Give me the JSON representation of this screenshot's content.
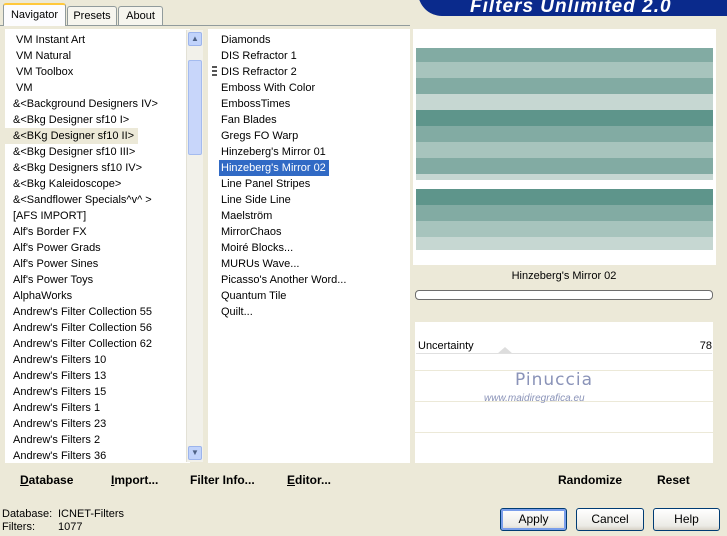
{
  "tabs": [
    {
      "label": "Navigator",
      "active": true
    },
    {
      "label": "Presets",
      "active": false
    },
    {
      "label": "About",
      "active": false
    }
  ],
  "banner_title": "Filters Unlimited 2.0",
  "categories": [
    "VM Instant Art",
    "VM Natural",
    "VM Toolbox",
    "VM",
    "&<Background Designers IV>",
    "&<Bkg Designer sf10 I>",
    "&<BKg Designer sf10 II>",
    "&<Bkg Designer sf10 III>",
    "&<Bkg Designers sf10 IV>",
    "&<Bkg Kaleidoscope>",
    "&<Sandflower Specials^v^ >",
    "[AFS IMPORT]",
    "Alf's Border FX",
    "Alf's Power Grads",
    "Alf's Power Sines",
    "Alf's Power Toys",
    "AlphaWorks",
    "Andrew's Filter Collection 55",
    "Andrew's Filter Collection 56",
    "Andrew's Filter Collection 62",
    "Andrew's Filters 10",
    "Andrew's Filters 13",
    "Andrew's Filters 15",
    "Andrew's Filters 1",
    "Andrew's Filters 23",
    "Andrew's Filters 2",
    "Andrew's Filters 36"
  ],
  "selected_category_index": 6,
  "filters": [
    "Diamonds",
    "DIS Refractor 1",
    "DIS Refractor 2",
    "Emboss With Color",
    "EmbossTimes",
    "Fan Blades",
    "Gregs FO Warp",
    "Hinzeberg's Mirror 01",
    "Hinzeberg's Mirror 02",
    "Line Panel Stripes",
    "Line Side Line",
    "Maelström",
    "MirrorChaos",
    "Moiré Blocks...",
    "MURUs Wave...",
    "Picasso's Another Word...",
    "Quantum Tile",
    "Quilt..."
  ],
  "selected_filter_index": 8,
  "preview": {
    "filter_name": "Hinzeberg's Mirror 02",
    "colors": {
      "teal_dark": "#5e958b",
      "teal_mid": "#82aba3",
      "teal_light": "#a7c4bd",
      "pale": "#c6d7d2"
    }
  },
  "sliders": [
    {
      "label": "Uncertainty",
      "value": 78
    }
  ],
  "watermark": {
    "name": "Pinuccia",
    "url": "www.maidiregrafica.eu"
  },
  "left_buttons": [
    {
      "label": "Database",
      "underline": "D",
      "rest": "atabase"
    },
    {
      "label": "Import...",
      "underline": "I",
      "rest": "mport..."
    },
    {
      "label": "Filter Info...",
      "underline": "",
      "rest": "Filter Info..."
    },
    {
      "label": "Editor...",
      "underline": "E",
      "rest": "ditor..."
    }
  ],
  "right_buttons": {
    "randomize": "Randomize",
    "reset": "Reset"
  },
  "status": {
    "database_label": "Database:",
    "database_value": "ICNET-Filters",
    "filters_label": "Filters:",
    "filters_value": "1077"
  },
  "dialog_buttons": {
    "apply": "Apply",
    "cancel": "Cancel",
    "help": "Help"
  }
}
